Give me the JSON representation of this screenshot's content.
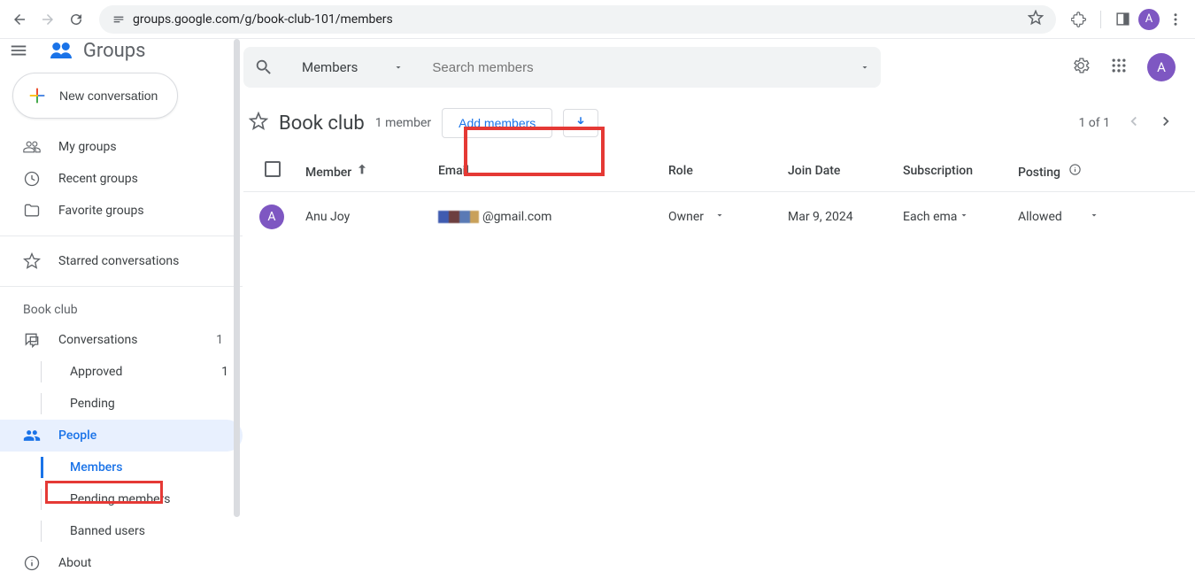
{
  "browser": {
    "url": "groups.google.com/g/book-club-101/members",
    "avatar_letter": "A"
  },
  "brand": {
    "name": "Groups"
  },
  "search": {
    "scope": "Members",
    "placeholder": "Search members"
  },
  "header": {
    "avatar_letter": "A"
  },
  "sidebar": {
    "new_conversation": "New conversation",
    "items": [
      {
        "label": "My groups"
      },
      {
        "label": "Recent groups"
      },
      {
        "label": "Favorite groups"
      }
    ],
    "starred": "Starred conversations",
    "group_label": "Book club",
    "conversations": {
      "label": "Conversations",
      "count": "1"
    },
    "approved": {
      "label": "Approved",
      "count": "1"
    },
    "pending": {
      "label": "Pending"
    },
    "people": {
      "label": "People"
    },
    "members": {
      "label": "Members"
    },
    "pending_members": {
      "label": "Pending members"
    },
    "banned": {
      "label": "Banned users"
    },
    "about": {
      "label": "About"
    }
  },
  "content": {
    "title": "Book club",
    "member_count": "1 member",
    "add_members": "Add members",
    "pager": "1 of 1",
    "columns": {
      "member": "Member",
      "email": "Email",
      "role": "Role",
      "join_date": "Join Date",
      "subscription": "Subscription",
      "posting": "Posting"
    },
    "rows": [
      {
        "avatar": "A",
        "name": "Anu Joy",
        "email_suffix": "@gmail.com",
        "role": "Owner",
        "join_date": "Mar 9, 2024",
        "subscription": "Each ema",
        "posting": "Allowed"
      }
    ]
  }
}
